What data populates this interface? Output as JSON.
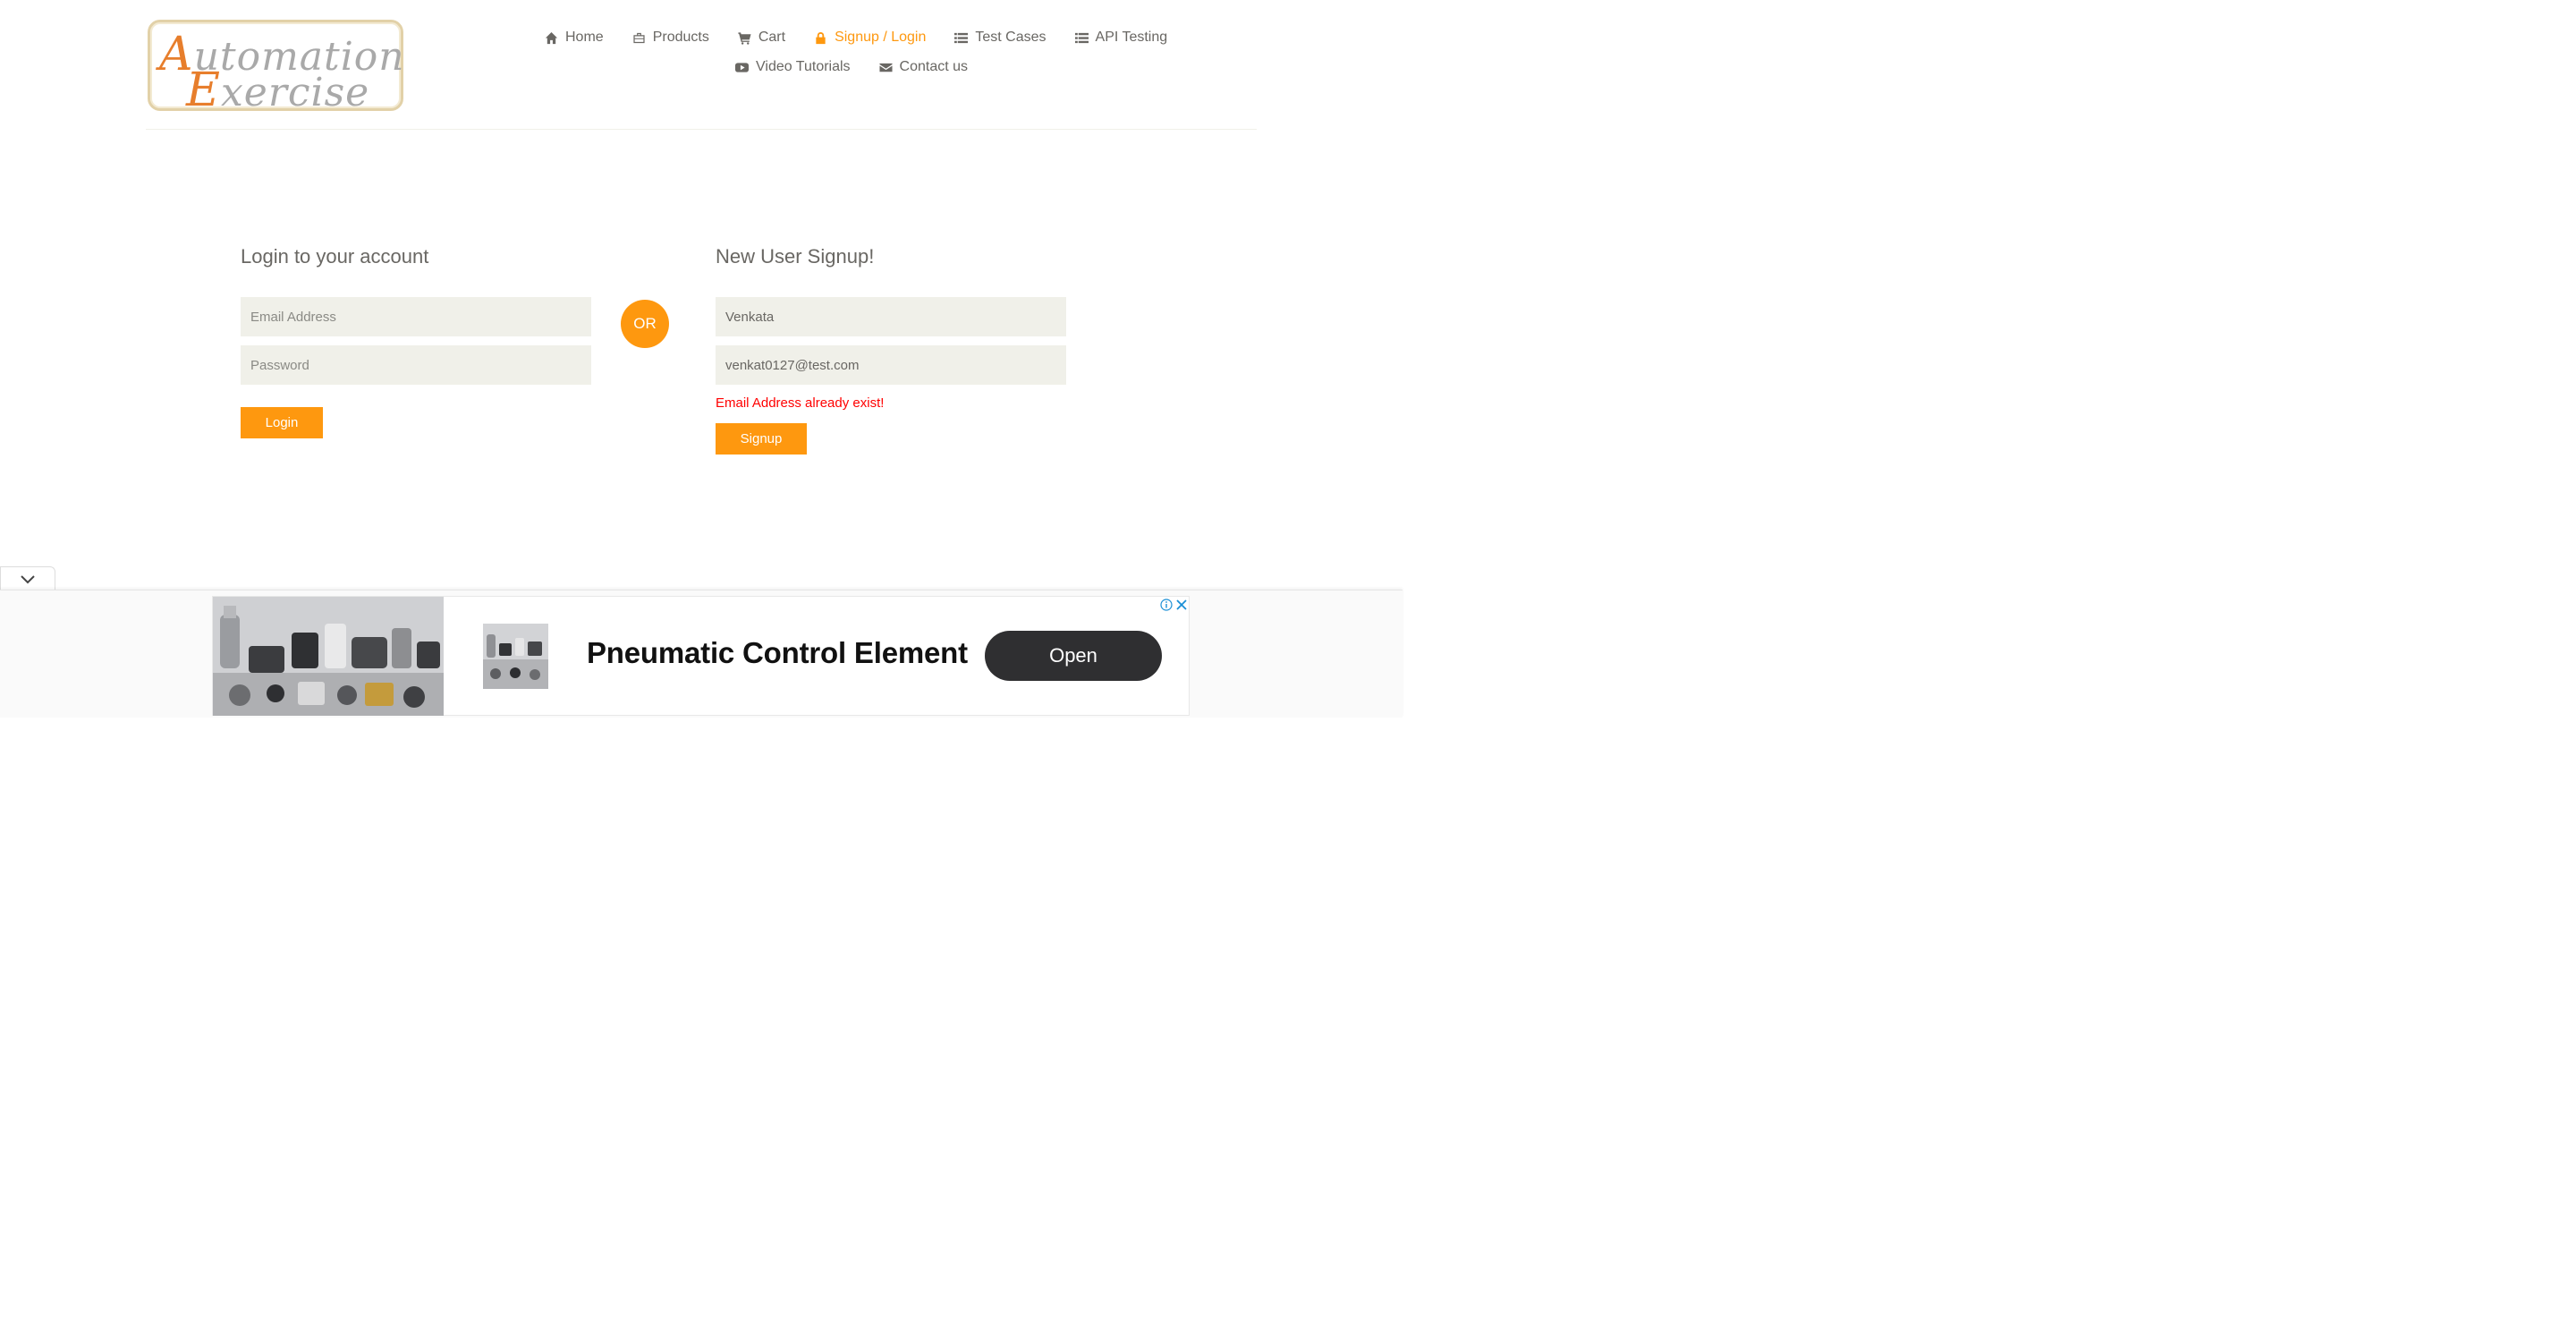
{
  "logo": {
    "line1_cap": "A",
    "line1_rest": "utomation",
    "line2_cap": "E",
    "line2_rest": "xercise"
  },
  "nav": {
    "home": "Home",
    "products": "Products",
    "cart": "Cart",
    "signup_login": "Signup / Login",
    "test_cases": "Test Cases",
    "api_testing": "API Testing",
    "video_tutorials": "Video Tutorials",
    "contact_us": "Contact us"
  },
  "login": {
    "title": "Login to your account",
    "email_placeholder": "Email Address",
    "password_placeholder": "Password",
    "button": "Login"
  },
  "or_label": "OR",
  "signup": {
    "title": "New User Signup!",
    "name_value": "Venkata",
    "email_value": "venkat0127@test.com",
    "error": "Email Address already exist!",
    "button": "Signup"
  },
  "ad": {
    "headline": "Pneumatic Control Element",
    "cta": "Open"
  },
  "colors": {
    "accent": "#fe980f",
    "text": "#696763",
    "field_bg": "#f0f0e9",
    "error": "#ff0000"
  }
}
